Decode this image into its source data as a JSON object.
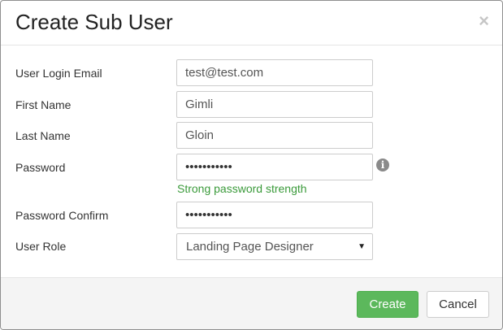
{
  "dialog": {
    "title": "Create Sub User",
    "close_symbol": "×"
  },
  "form": {
    "email": {
      "label": "User Login Email",
      "value": "test@test.com"
    },
    "first_name": {
      "label": "First Name",
      "value": "Gimli"
    },
    "last_name": {
      "label": "Last Name",
      "value": "Gloin"
    },
    "password": {
      "label": "Password",
      "masked_value": "•••••••••••",
      "strength_text": "Strong password strength",
      "info_icon": "info-circle-icon"
    },
    "password_confirm": {
      "label": "Password Confirm",
      "masked_value": "•••••••••••"
    },
    "user_role": {
      "label": "User Role",
      "selected": "Landing Page Designer"
    }
  },
  "footer": {
    "create_label": "Create",
    "cancel_label": "Cancel"
  },
  "colors": {
    "create_button": "#5cb85c",
    "strength_text": "#3a9a3a"
  }
}
